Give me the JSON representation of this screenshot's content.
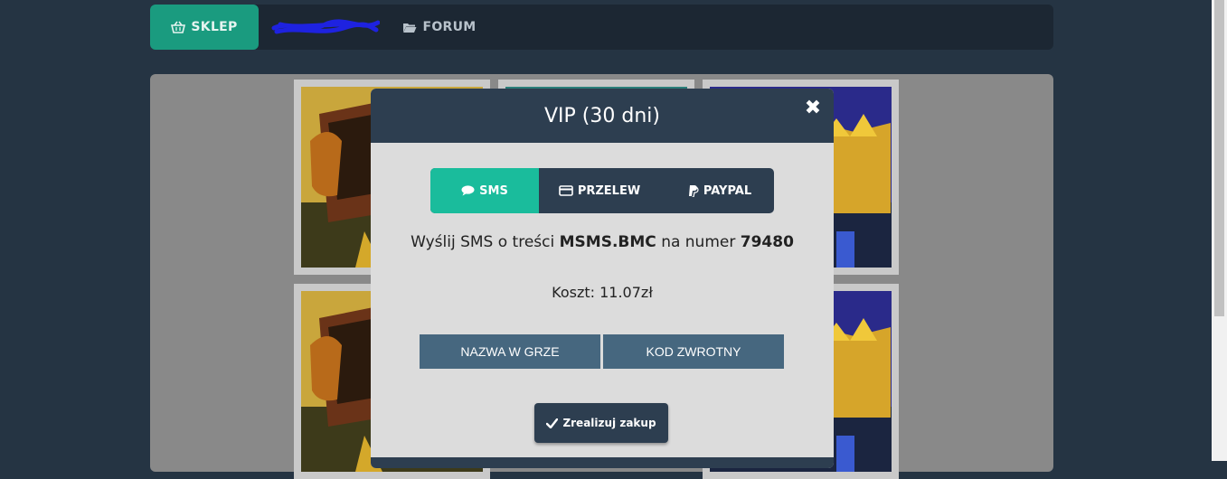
{
  "nav": {
    "tabs": [
      {
        "label": "SKLEP",
        "icon": "basket-icon",
        "active": true
      },
      {
        "label": "",
        "icon": "scribble-redacted"
      },
      {
        "label": "FORUM",
        "icon": "folder-open-icon"
      }
    ]
  },
  "modal": {
    "title": "VIP (30 dni)",
    "close_symbol": "✖",
    "payment_tabs": [
      {
        "label": "SMS",
        "icon": "comment-icon",
        "active": true
      },
      {
        "label": "PRZELEW",
        "icon": "credit-card-icon"
      },
      {
        "label": "PAYPAL",
        "icon": "paypal-icon"
      }
    ],
    "sms_text_prefix": "Wyślij SMS o treści",
    "sms_code": "MSMS.BMC",
    "sms_text_middle": "na numer",
    "sms_number": "79480",
    "cost_text": "Koszt: 11.07zł",
    "fields": [
      {
        "label": "NAZWA W GRZE"
      },
      {
        "label": "KOD ZWROTNY"
      }
    ],
    "submit_label": "Zrealizuj zakup"
  },
  "colors": {
    "accent": "#1abc9c",
    "header": "#2d3e50",
    "field_button": "#46677f",
    "background": "#253443"
  }
}
